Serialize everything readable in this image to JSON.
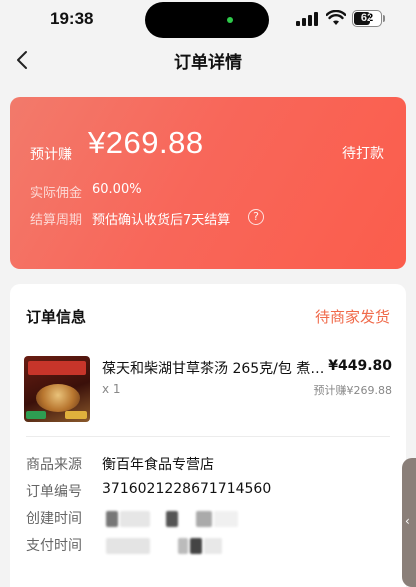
{
  "status_bar": {
    "time": "19:38",
    "battery": "62"
  },
  "navbar": {
    "back_icon": "chevron-left-icon",
    "title": "订单详情"
  },
  "earnings": {
    "label": "预计赚",
    "amount": "¥269.88",
    "status": "待打款",
    "commission_label": "实际佣金",
    "commission_value": "60.00%",
    "cycle_label": "结算周期",
    "cycle_value": "预估确认收货后7天结算",
    "help_icon": "question-circle-icon",
    "gradient_color": "#f8675a"
  },
  "order_info": {
    "title": "订单信息",
    "status": "待商家发货",
    "status_color": "#f06a4a",
    "product": {
      "name": "葆天和柴湖甘草茶汤 265克/包 煮水...",
      "price": "¥449.80",
      "quantity": "x 1",
      "estimated_earn": "预计赚¥269.88"
    },
    "rows": [
      {
        "label": "商品来源",
        "value": "衡百年食品专营店"
      },
      {
        "label": "订单编号",
        "value": "3716021228671714560"
      },
      {
        "label": "创建时间",
        "value": ""
      },
      {
        "label": "支付时间",
        "value": ""
      }
    ]
  },
  "side_tab": {
    "icon": "chevron-left-icon"
  }
}
